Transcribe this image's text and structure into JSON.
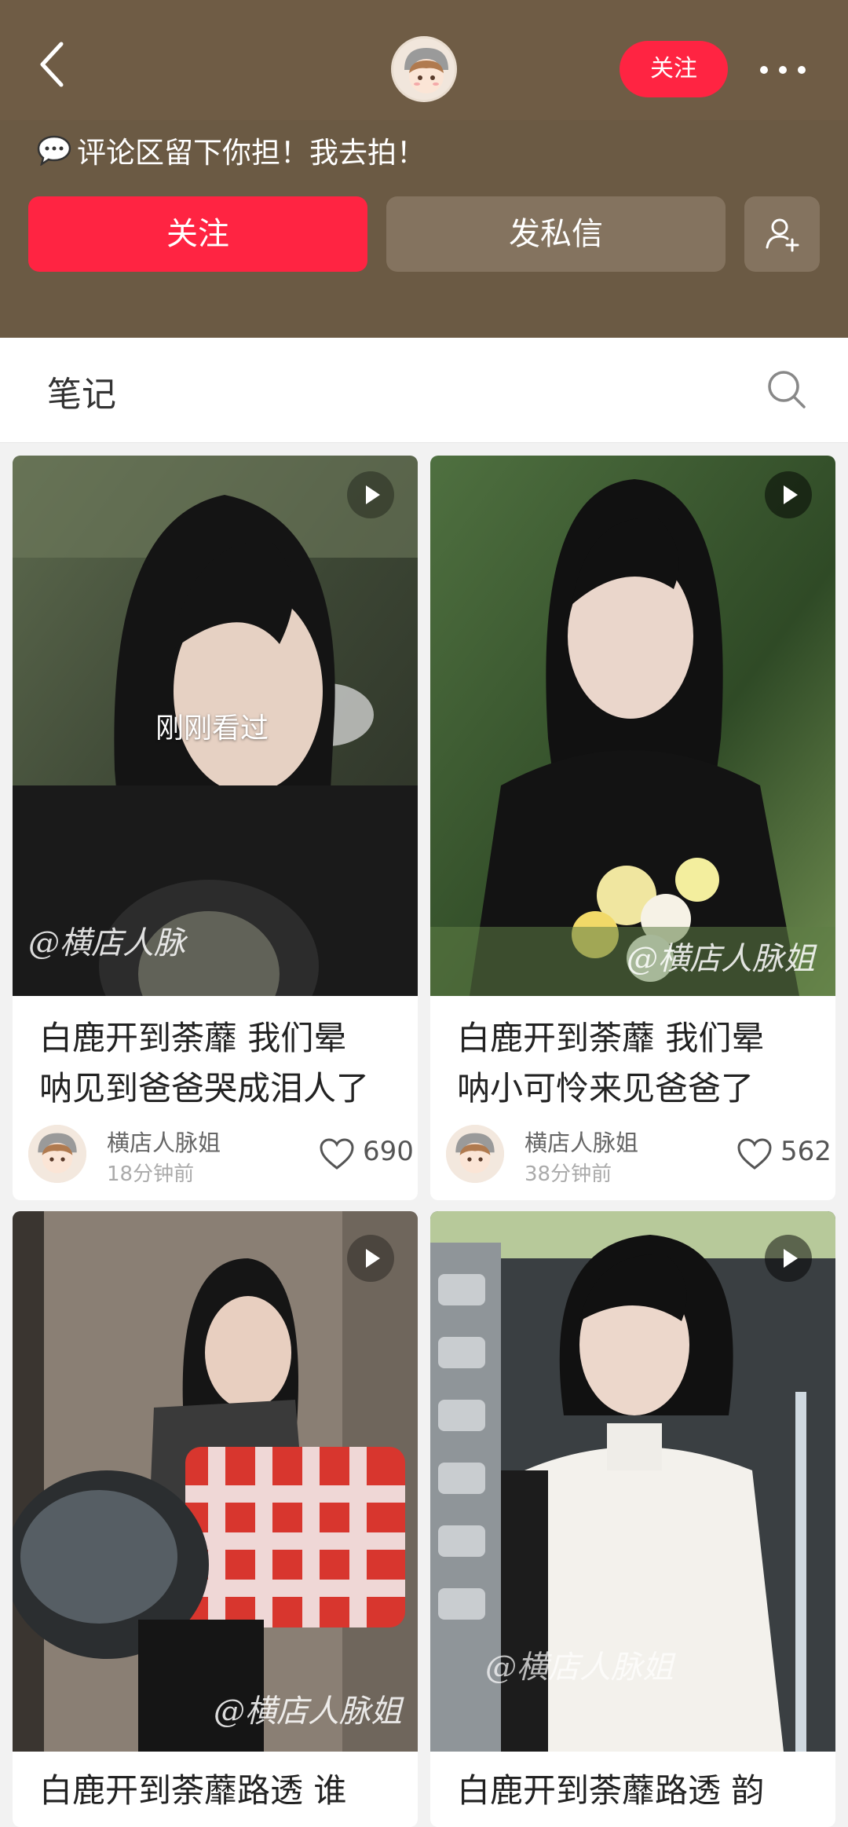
{
  "header": {
    "follow_small_label": "关注",
    "bio_text": "评论区留下你担！我去拍！",
    "follow_label": "关注",
    "dm_label": "发私信"
  },
  "tabs": {
    "notes_label": "笔记"
  },
  "feed": {
    "items": [
      {
        "title_line1": "白鹿开到荼蘼 我们晕",
        "title_line2": "呐见到爸爸哭成泪人了",
        "author": "横店人脉姐",
        "time": "18分钟前",
        "likes": "690",
        "watermark": "@横店人脉",
        "seen_label": "刚刚看过",
        "is_video": true
      },
      {
        "title_line1": "白鹿开到荼蘼 我们晕",
        "title_line2": "呐小可怜来见爸爸了",
        "author": "横店人脉姐",
        "time": "38分钟前",
        "likes": "562",
        "watermark": "@横店人脉姐",
        "is_video": true
      },
      {
        "title_line1": "白鹿开到荼蘼路透 谁",
        "watermark": "@横店人脉姐",
        "is_video": true
      },
      {
        "title_line1": "白鹿开到荼蘼路透 韵",
        "watermark": "@横店人脉姐",
        "is_video": true
      }
    ]
  },
  "colors": {
    "header_bg": "#6b5a44",
    "brand_red": "#ff2442",
    "secondary_btn": "#84735f"
  },
  "icons": [
    "back-arrow-icon",
    "avatar",
    "more-dots-icon",
    "speech-bubble-icon",
    "add-user-icon",
    "search-icon",
    "play-icon",
    "heart-icon"
  ]
}
